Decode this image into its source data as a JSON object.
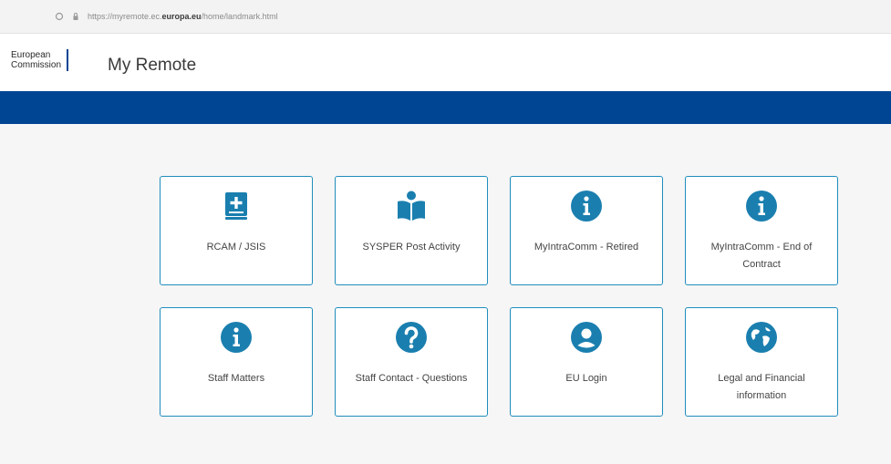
{
  "browser": {
    "url_prefix": "https://myremote.ec.",
    "url_domain": "europa.eu",
    "url_suffix": "/home/landmark.html"
  },
  "header": {
    "logo_line1": "European",
    "logo_line2": "Commission",
    "app_title": "My Remote"
  },
  "colors": {
    "brand_blue": "#004494",
    "tile_border": "#1f8dbd",
    "icon_blue": "#1a7faf"
  },
  "tiles": [
    {
      "label": "RCAM / JSIS",
      "icon": "medical-book-icon"
    },
    {
      "label": "SYSPER Post Activity",
      "icon": "reader-icon"
    },
    {
      "label": "MyIntraComm - Retired",
      "icon": "info-icon"
    },
    {
      "label": "MyIntraComm - End of Contract",
      "icon": "info-icon"
    },
    {
      "label": "Staff Matters",
      "icon": "info-icon"
    },
    {
      "label": "Staff Contact - Questions",
      "icon": "question-icon"
    },
    {
      "label": "EU Login",
      "icon": "user-icon"
    },
    {
      "label": "Legal and Financial information",
      "icon": "globe-icon"
    }
  ]
}
